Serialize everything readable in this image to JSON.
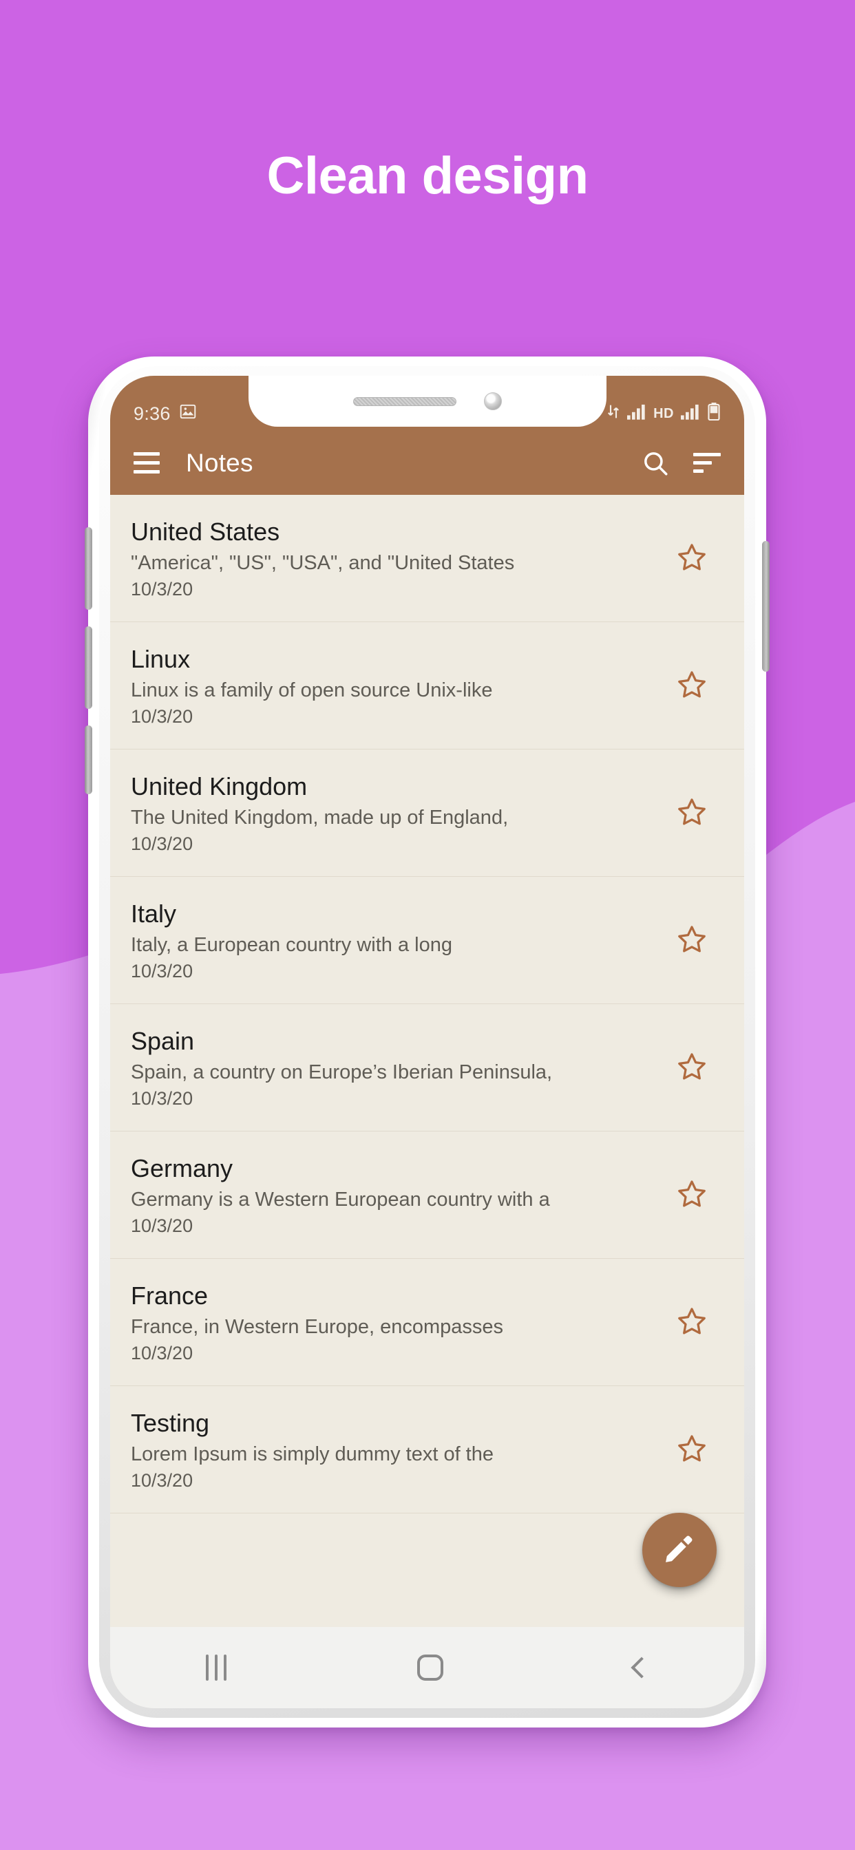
{
  "headline": "Clean design",
  "theme": {
    "bg_top": "#CC63E4",
    "bg_wave": "#DC92F0",
    "app_bar": "#A5714C",
    "list_bg": "#EFEBE1",
    "accent_brown": "#A5714C",
    "star_outline": "#B06A3E",
    "title_text": "#1C1C1C",
    "secondary_text": "#5F5C55",
    "divider": "#E0DACD"
  },
  "status_bar": {
    "time": "9:36",
    "left_icons": [
      "image-icon"
    ],
    "right_icons": [
      "data-transfer-icon",
      "signal-bars-icon",
      "hd-icon",
      "signal-bars-icon",
      "battery-icon"
    ],
    "hd_label": "HD"
  },
  "app_bar": {
    "menu_icon": "hamburger-menu-icon",
    "title": "Notes",
    "search_icon": "search-icon",
    "sort_icon": "sort-icon"
  },
  "notes": [
    {
      "title": "United States",
      "snippet": "\"America\", \"US\", \"USA\", and \"United States",
      "date": "10/3/20",
      "starred": false
    },
    {
      "title": "Linux",
      "snippet": "Linux is a family of open source Unix-like",
      "date": "10/3/20",
      "starred": false
    },
    {
      "title": "United Kingdom",
      "snippet": "The United Kingdom, made up of England,",
      "date": "10/3/20",
      "starred": false
    },
    {
      "title": "Italy",
      "snippet": "Italy, a European country with a long",
      "date": "10/3/20",
      "starred": false
    },
    {
      "title": "Spain",
      "snippet": "Spain, a country on Europe’s Iberian Peninsula,",
      "date": "10/3/20",
      "starred": false
    },
    {
      "title": "Germany",
      "snippet": "Germany is a Western European country with a",
      "date": "10/3/20",
      "starred": false
    },
    {
      "title": "France",
      "snippet": "France, in Western Europe, encompasses",
      "date": "10/3/20",
      "starred": false
    },
    {
      "title": "Testing",
      "snippet": "Lorem Ipsum is simply dummy text of the",
      "date": "10/3/20",
      "starred": false
    }
  ],
  "fab": {
    "icon": "pencil-edit-icon"
  },
  "nav_bar": {
    "recents_icon": "recents-icon",
    "home_icon": "home-icon",
    "back_icon": "back-icon"
  }
}
